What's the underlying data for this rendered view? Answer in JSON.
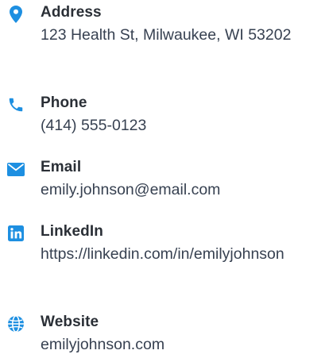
{
  "accent_color": "#1d8fe1",
  "contact": {
    "address": {
      "icon": "map-pin-icon",
      "label": "Address",
      "value": "123 Health St, Milwaukee, WI 53202"
    },
    "phone": {
      "icon": "phone-icon",
      "label": "Phone",
      "value": "(414) 555-0123"
    },
    "email": {
      "icon": "envelope-icon",
      "label": "Email",
      "value": "emily.johnson@email.com"
    },
    "linkedin": {
      "icon": "linkedin-icon",
      "label": "LinkedIn",
      "value": "https://linkedin.com/in/emilyjohnson"
    },
    "website": {
      "icon": "globe-icon",
      "label": "Website",
      "value": "emilyjohnson.com"
    }
  }
}
